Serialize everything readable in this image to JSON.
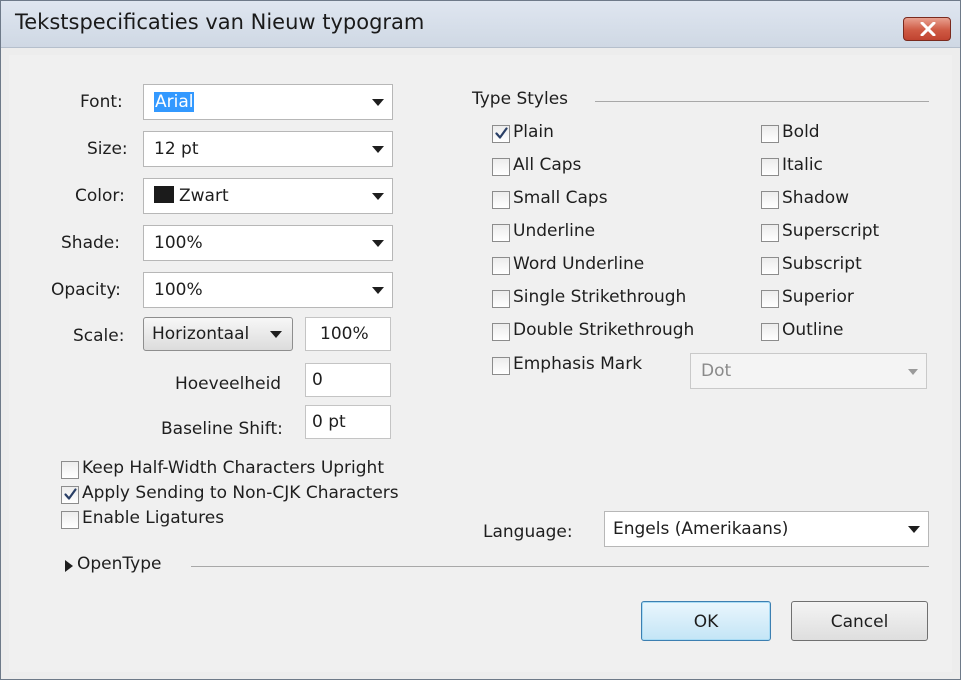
{
  "window": {
    "title": "Tekstspecificaties van Nieuw typogram"
  },
  "colors": {
    "title_bar": "#d6dee9",
    "close_button": "#cf5a44",
    "dialog_background": "#f0f0f0",
    "selection": "#3399ff",
    "default_button": "#c4e5f6"
  },
  "icons": {
    "close": "close-x-icon",
    "dropdown": "chevron-down-icon",
    "expander": "disclosure-triangle-icon",
    "check": "checkmark-icon"
  },
  "left": {
    "font": {
      "label": "Font:",
      "value": "Arial"
    },
    "size": {
      "label": "Size:",
      "value": "12 pt"
    },
    "color": {
      "label": "Color:",
      "value": "Zwart",
      "swatch_color": "#1b1b1b"
    },
    "shade": {
      "label": "Shade:",
      "value": "100%"
    },
    "opacity": {
      "label": "Opacity:",
      "value": "100%"
    },
    "scale": {
      "label": "Scale:",
      "mode": "Horizontaal",
      "value": "100%"
    },
    "hoeveelheid": {
      "label": "Hoeveelheid",
      "value": "0"
    },
    "baseline_shift": {
      "label": "Baseline Shift:",
      "value": "0 pt"
    }
  },
  "options": [
    {
      "label": "Keep Half-Width Characters Upright",
      "checked": false
    },
    {
      "label": "Apply Sending to Non-CJK Characters",
      "checked": true
    },
    {
      "label": "Enable Ligatures",
      "checked": false
    }
  ],
  "type_styles": {
    "heading": "Type Styles",
    "left_column": [
      {
        "label": "Plain",
        "checked": true
      },
      {
        "label": "All Caps",
        "checked": false
      },
      {
        "label": "Small Caps",
        "checked": false
      },
      {
        "label": "Underline",
        "checked": false
      },
      {
        "label": "Word Underline",
        "checked": false
      },
      {
        "label": "Single Strikethrough",
        "checked": false
      },
      {
        "label": "Double Strikethrough",
        "checked": false
      },
      {
        "label": "Emphasis Mark",
        "checked": false
      }
    ],
    "right_column": [
      {
        "label": "Bold",
        "checked": false
      },
      {
        "label": "Italic",
        "checked": false
      },
      {
        "label": "Shadow",
        "checked": false
      },
      {
        "label": "Superscript",
        "checked": false
      },
      {
        "label": "Subscript",
        "checked": false
      },
      {
        "label": "Superior",
        "checked": false
      },
      {
        "label": "Outline",
        "checked": false
      }
    ],
    "emphasis_mark_value": "Dot"
  },
  "language": {
    "label": "Language:",
    "value": "Engels (Amerikaans)"
  },
  "opentype": {
    "label": "OpenType"
  },
  "buttons": {
    "ok": "OK",
    "cancel": "Cancel"
  }
}
